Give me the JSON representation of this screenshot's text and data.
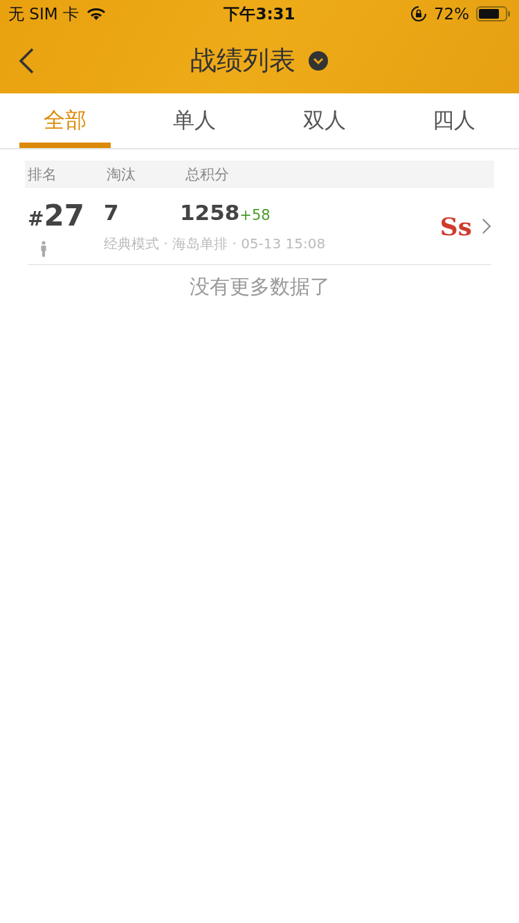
{
  "status_bar": {
    "carrier": "无 SIM 卡",
    "time": "下午3:31",
    "battery": "72%"
  },
  "header": {
    "title": "战绩列表"
  },
  "tabs": [
    {
      "label": "全部",
      "selected": true
    },
    {
      "label": "单人",
      "selected": false
    },
    {
      "label": "双人",
      "selected": false
    },
    {
      "label": "四人",
      "selected": false
    }
  ],
  "table": {
    "columns": [
      "排名",
      "淘汰",
      "总积分"
    ],
    "rows": [
      {
        "rank": "#",
        "rank_number": "27",
        "kills": "7",
        "score": "1258",
        "score_change": "+58",
        "details": "经典模式 · 海岛单排 · 05-13 15:08",
        "grade": "Ss"
      }
    ]
  },
  "footer": "没有更多数据了"
}
